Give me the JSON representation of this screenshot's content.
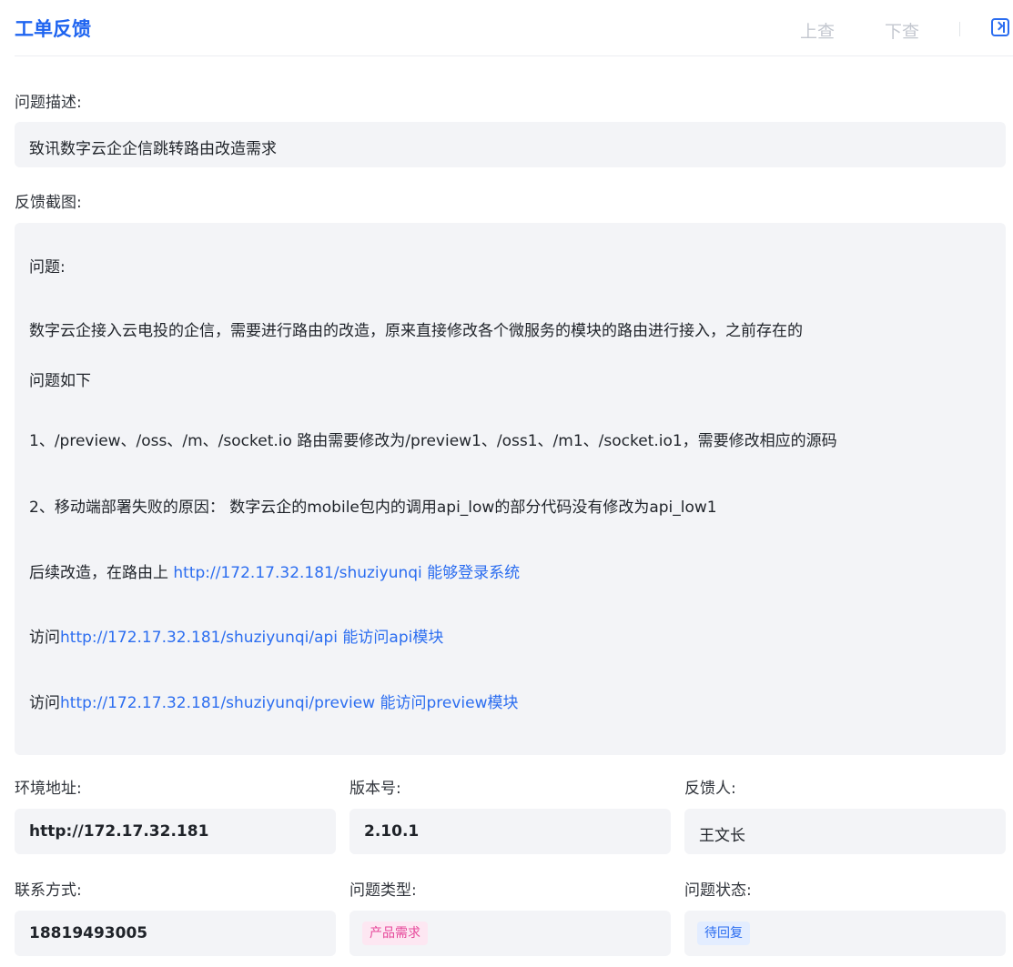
{
  "header": {
    "title": "工单反馈",
    "prev_label": "上查",
    "next_label": "下查",
    "collapse_icon": "panel-collapse-icon"
  },
  "description": {
    "label": "问题描述:",
    "value": "致讯数字云企企信跳转路由改造需求"
  },
  "screenshot": {
    "label": "反馈截图:",
    "lines": {
      "l1": "问题:",
      "l2": "数字云企接入云电投的企信，需要进行路由的改造，原来直接修改各个微服务的模块的路由进行接入，之前存在的",
      "l3": "问题如下",
      "l4": "1、/preview、/oss、/m、/socket.io 路由需要修改为/preview1、/oss1、/m1、/socket.io1，需要修改相应的源码",
      "l5": "2、移动端部署失败的原因： 数字云企的mobile包内的调用api_low的部分代码没有修改为api_low1",
      "l6_prefix": "后续改造，在路由上 ",
      "l6_link": "http://172.17.32.181/shuziyunqi",
      "l6_suffix": "   能够登录系统",
      "l7_prefix": "访问",
      "l7_link": "http://172.17.32.181/shuziyunqi/api",
      "l7_suffix": "  能访问api模块",
      "l8_prefix": "访问",
      "l8_link": "http://172.17.32.181/shuziyunqi/preview",
      "l8_suffix": " 能访问preview模块"
    }
  },
  "info": {
    "env_label": "环境地址:",
    "env_value": "http://172.17.32.181",
    "version_label": "版本号:",
    "version_value": "2.10.1",
    "reporter_label": "反馈人:",
    "reporter_value": "王文长",
    "contact_label": "联系方式:",
    "contact_value": "18819493005",
    "type_label": "问题类型:",
    "type_value": "产品需求",
    "status_label": "问题状态:",
    "status_value": "待回复"
  },
  "colors": {
    "accent": "#1e64f0",
    "link": "#2b6df0",
    "type_tag": "#e6479a",
    "status_tag": "#2b6df0"
  }
}
